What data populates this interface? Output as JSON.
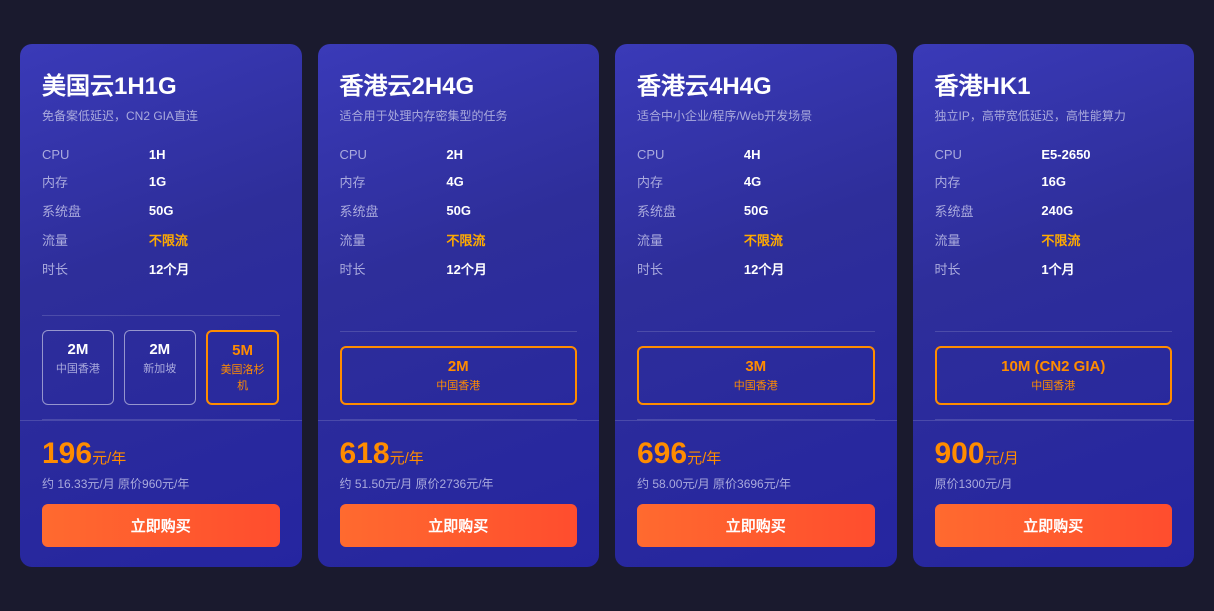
{
  "cards": [
    {
      "id": "us-1h1g",
      "title": "美国云1H1G",
      "subtitle": "免备案低延迟，CN2 GIA直连",
      "specs": [
        {
          "label": "CPU",
          "value": "1H",
          "highlight": false
        },
        {
          "label": "内存",
          "value": "1G",
          "highlight": false
        },
        {
          "label": "系统盘",
          "value": "50G",
          "highlight": false
        },
        {
          "label": "流量",
          "value": "不限流",
          "highlight": true
        },
        {
          "label": "时长",
          "value": "12个月",
          "highlight": false
        }
      ],
      "bandwidth_options": [
        {
          "speed": "2M",
          "location": "中国香港",
          "active": false
        },
        {
          "speed": "2M",
          "location": "新加坡",
          "active": false
        },
        {
          "speed": "5M",
          "location": "美国洛杉机",
          "active": true
        }
      ],
      "price": "196",
      "price_unit": "元/年",
      "price_sub": "约 16.33元/月 原价960元/年",
      "buy_label": "立即购买"
    },
    {
      "id": "hk-2h4g",
      "title": "香港云2H4G",
      "subtitle": "适合用于处理内存密集型的任务",
      "specs": [
        {
          "label": "CPU",
          "value": "2H",
          "highlight": false
        },
        {
          "label": "内存",
          "value": "4G",
          "highlight": false
        },
        {
          "label": "系统盘",
          "value": "50G",
          "highlight": false
        },
        {
          "label": "流量",
          "value": "不限流",
          "highlight": true
        },
        {
          "label": "时长",
          "value": "12个月",
          "highlight": false
        }
      ],
      "bandwidth_options": [
        {
          "speed": "2M",
          "location": "中国香港",
          "active": true
        }
      ],
      "price": "618",
      "price_unit": "元/年",
      "price_sub": "约 51.50元/月 原价2736元/年",
      "buy_label": "立即购买"
    },
    {
      "id": "hk-4h4g",
      "title": "香港云4H4G",
      "subtitle": "适合中小企业/程序/Web开发场景",
      "specs": [
        {
          "label": "CPU",
          "value": "4H",
          "highlight": false
        },
        {
          "label": "内存",
          "value": "4G",
          "highlight": false
        },
        {
          "label": "系统盘",
          "value": "50G",
          "highlight": false
        },
        {
          "label": "流量",
          "value": "不限流",
          "highlight": true
        },
        {
          "label": "时长",
          "value": "12个月",
          "highlight": false
        }
      ],
      "bandwidth_options": [
        {
          "speed": "3M",
          "location": "中国香港",
          "active": true
        }
      ],
      "price": "696",
      "price_unit": "元/年",
      "price_sub": "约 58.00元/月 原价3696元/年",
      "buy_label": "立即购买"
    },
    {
      "id": "hk-hk1",
      "title": "香港HK1",
      "subtitle": "独立IP，高带宽低延迟，高性能算力",
      "specs": [
        {
          "label": "CPU",
          "value": "E5-2650",
          "highlight": false
        },
        {
          "label": "内存",
          "value": "16G",
          "highlight": false
        },
        {
          "label": "系统盘",
          "value": "240G",
          "highlight": false
        },
        {
          "label": "流量",
          "value": "不限流",
          "highlight": true
        },
        {
          "label": "时长",
          "value": "1个月",
          "highlight": false
        }
      ],
      "bandwidth_options": [
        {
          "speed": "10M (CN2 GIA)",
          "location": "中国香港",
          "active": true
        }
      ],
      "price": "900",
      "price_unit": "元/月",
      "price_sub": "原价1300元/月",
      "buy_label": "立即购买"
    }
  ]
}
